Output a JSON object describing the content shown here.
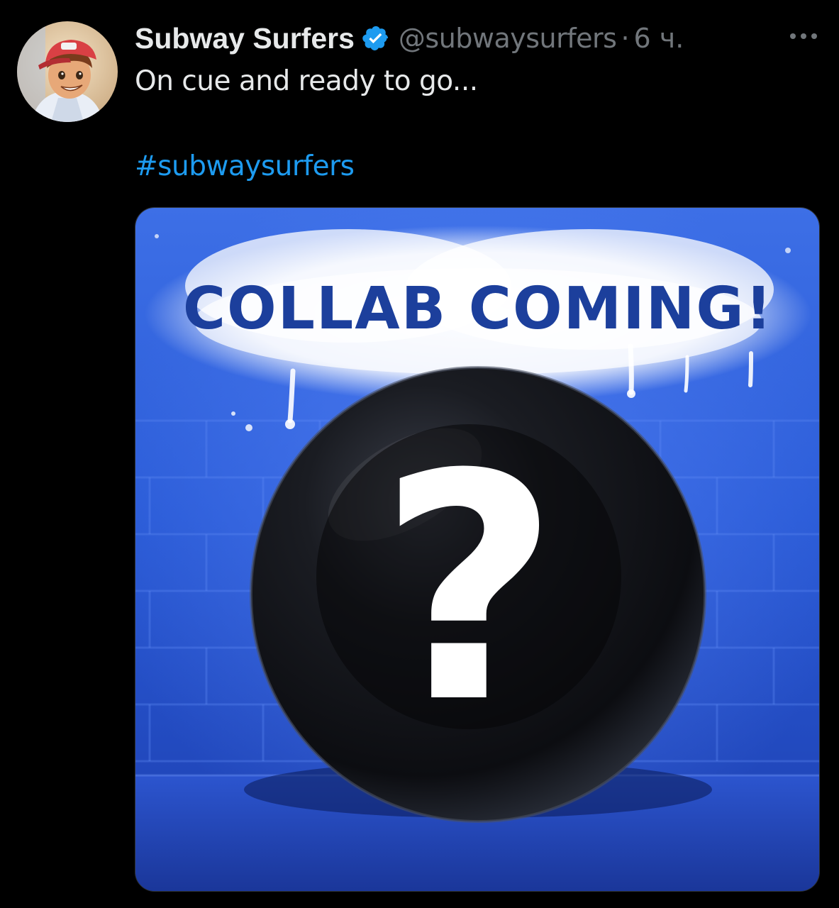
{
  "tweet": {
    "author": {
      "display_name": "Subway Surfers",
      "handle": "@subwaysurfers",
      "verified": true,
      "avatar_icon": "character-avatar"
    },
    "separator": "·",
    "timestamp": "6 ч.",
    "more_icon": "more-horizontal-icon",
    "text": "On cue and ready to go...",
    "hashtag": "#subwaysurfers",
    "media": {
      "headline": "COLLAB COMING!",
      "symbol": "?"
    }
  },
  "colors": {
    "background": "#000000",
    "primary_text": "#e7e9ea",
    "secondary_text": "#71767b",
    "link": "#1d9bf0",
    "verified_badge": "#1d9bf0",
    "media_blue": "#2a5bd7",
    "headline_navy": "#1c3f9c"
  }
}
